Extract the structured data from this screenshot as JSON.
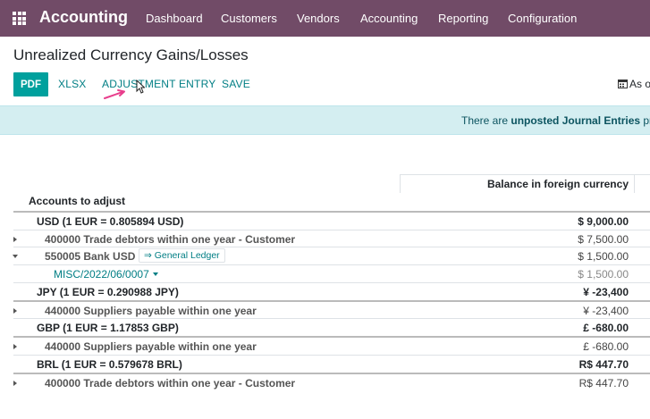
{
  "navbar": {
    "app_name": "Accounting",
    "items": [
      "Dashboard",
      "Customers",
      "Vendors",
      "Accounting",
      "Reporting",
      "Configuration"
    ],
    "bg_color": "#714b67"
  },
  "page": {
    "title": "Unrealized Currency Gains/Losses"
  },
  "toolbar": {
    "pdf": "PDF",
    "xlsx": "XLSX",
    "adjustment_entry": "ADJUSTMENT ENTRY",
    "save": "SAVE",
    "date_filter": "As of",
    "accent_color": "#00a09d"
  },
  "alert": {
    "prefix": "There are ",
    "link": "unposted Journal Entries",
    "suffix": " prior"
  },
  "report": {
    "column_header": "Balance in foreign currency",
    "section_label": "Accounts to adjust",
    "rows": [
      {
        "type": "currency",
        "label": "USD (1 EUR = 0.805894 USD)",
        "amount": "$ 9,000.00"
      },
      {
        "type": "account",
        "label": "400000 Trade debtors within one year - Customer",
        "amount": "$ 7,500.00",
        "expanded": false
      },
      {
        "type": "account",
        "label": "550005 Bank USD",
        "amount": "$ 1,500.00",
        "expanded": true,
        "badge": "⇒ General Ledger"
      },
      {
        "type": "move",
        "label": "MISC/2022/06/0007",
        "amount": "$ 1,500.00"
      },
      {
        "type": "currency",
        "label": "JPY (1 EUR = 0.290988 JPY)",
        "amount": "¥ -23,400"
      },
      {
        "type": "account",
        "label": "440000 Suppliers payable within one year",
        "amount": "¥ -23,400",
        "expanded": false
      },
      {
        "type": "currency",
        "label": "GBP (1 EUR = 1.17853 GBP)",
        "amount": "£ -680.00"
      },
      {
        "type": "account",
        "label": "440000 Suppliers payable within one year",
        "amount": "£ -680.00",
        "expanded": false
      },
      {
        "type": "currency",
        "label": "BRL (1 EUR = 0.579678 BRL)",
        "amount": "R$ 447.70"
      },
      {
        "type": "account",
        "label": "400000 Trade debtors within one year - Customer",
        "amount": "R$ 447.70",
        "expanded": false
      }
    ]
  }
}
